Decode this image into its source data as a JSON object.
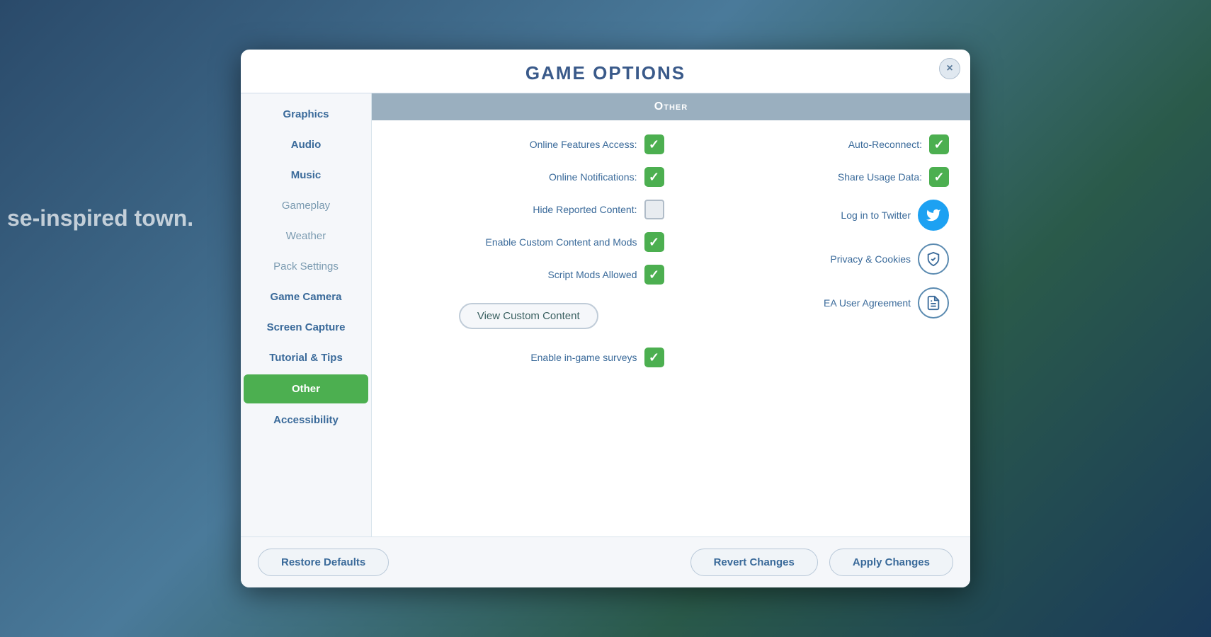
{
  "modal": {
    "title": "Game Options",
    "close_label": "×"
  },
  "sidebar": {
    "items": [
      {
        "id": "graphics",
        "label": "Graphics",
        "active": false,
        "bold": true
      },
      {
        "id": "audio",
        "label": "Audio",
        "active": false,
        "bold": true
      },
      {
        "id": "music",
        "label": "Music",
        "active": false,
        "bold": true
      },
      {
        "id": "gameplay",
        "label": "Gameplay",
        "active": false,
        "bold": false
      },
      {
        "id": "weather",
        "label": "Weather",
        "active": false,
        "bold": false
      },
      {
        "id": "pack-settings",
        "label": "Pack Settings",
        "active": false,
        "bold": false
      },
      {
        "id": "game-camera",
        "label": "Game Camera",
        "active": false,
        "bold": true
      },
      {
        "id": "screen-capture",
        "label": "Screen Capture",
        "active": false,
        "bold": true
      },
      {
        "id": "tutorial-tips",
        "label": "Tutorial & Tips",
        "active": false,
        "bold": true
      },
      {
        "id": "other",
        "label": "Other",
        "active": true,
        "bold": true
      },
      {
        "id": "accessibility",
        "label": "Accessibility",
        "active": false,
        "bold": true
      }
    ]
  },
  "content": {
    "header": "Other",
    "left_options": [
      {
        "id": "online-features",
        "label": "Online Features Access:",
        "checked": true,
        "type": "checkbox"
      },
      {
        "id": "online-notifications",
        "label": "Online Notifications:",
        "checked": true,
        "type": "checkbox"
      },
      {
        "id": "hide-reported",
        "label": "Hide Reported Content:",
        "checked": false,
        "type": "checkbox"
      },
      {
        "id": "enable-custom-mods",
        "label": "Enable Custom Content and Mods",
        "checked": true,
        "type": "checkbox"
      },
      {
        "id": "script-mods",
        "label": "Script Mods Allowed",
        "checked": true,
        "type": "checkbox"
      },
      {
        "id": "view-cc",
        "label": "View Custom Content",
        "type": "button"
      },
      {
        "id": "enable-surveys",
        "label": "Enable in-game surveys",
        "checked": true,
        "type": "checkbox"
      }
    ],
    "right_options": [
      {
        "id": "auto-reconnect",
        "label": "Auto-Reconnect:",
        "checked": true,
        "type": "checkbox"
      },
      {
        "id": "share-usage",
        "label": "Share Usage Data:",
        "checked": true,
        "type": "checkbox"
      },
      {
        "id": "log-twitter",
        "label": "Log in to Twitter",
        "type": "twitter-icon"
      },
      {
        "id": "privacy-cookies",
        "label": "Privacy & Cookies",
        "type": "shield-icon"
      },
      {
        "id": "ea-agreement",
        "label": "EA User Agreement",
        "type": "doc-icon"
      }
    ]
  },
  "footer": {
    "restore_label": "Restore Defaults",
    "revert_label": "Revert Changes",
    "apply_label": "Apply Changes"
  }
}
